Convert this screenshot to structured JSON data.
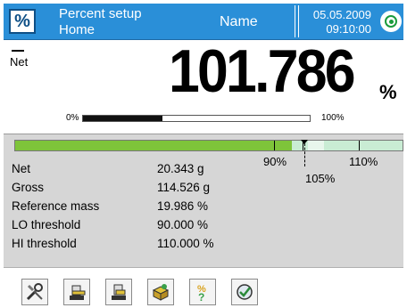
{
  "header": {
    "mode_title": "Percent setup",
    "profile": "Home",
    "user_name": "Name",
    "date": "05.05.2009",
    "time": "09:10:00",
    "mode_icon_text": "%",
    "bg_color": "#2a8fd8"
  },
  "result": {
    "stable_symbol": "net-symbol",
    "net_label": "Net",
    "value": "101.786",
    "unit": "%",
    "progress": {
      "min_label": "0%",
      "max_label": "100%",
      "fraction": 0.35
    }
  },
  "threshold_bar": {
    "lo_label": "90%",
    "target_label": "105%",
    "hi_label": "110%",
    "green_color": "#7ec43a",
    "light_color": "#c9ecd4"
  },
  "info": [
    {
      "label": "Net",
      "value": "20.343 g"
    },
    {
      "label": "Gross",
      "value": "114.526 g"
    },
    {
      "label": "Reference mass",
      "value": "19.986 %"
    },
    {
      "label": "LO threshold",
      "value": "90.000 %"
    },
    {
      "label": "HI threshold",
      "value": "110.000 %"
    }
  ],
  "toolbar": {
    "buttons": [
      {
        "icon": "tools-icon"
      },
      {
        "icon": "scale-tare-icon"
      },
      {
        "icon": "scale-reference-icon"
      },
      {
        "icon": "package-icon"
      },
      {
        "icon": "percent-query-icon"
      },
      {
        "icon": "gauge-check-icon"
      }
    ]
  }
}
